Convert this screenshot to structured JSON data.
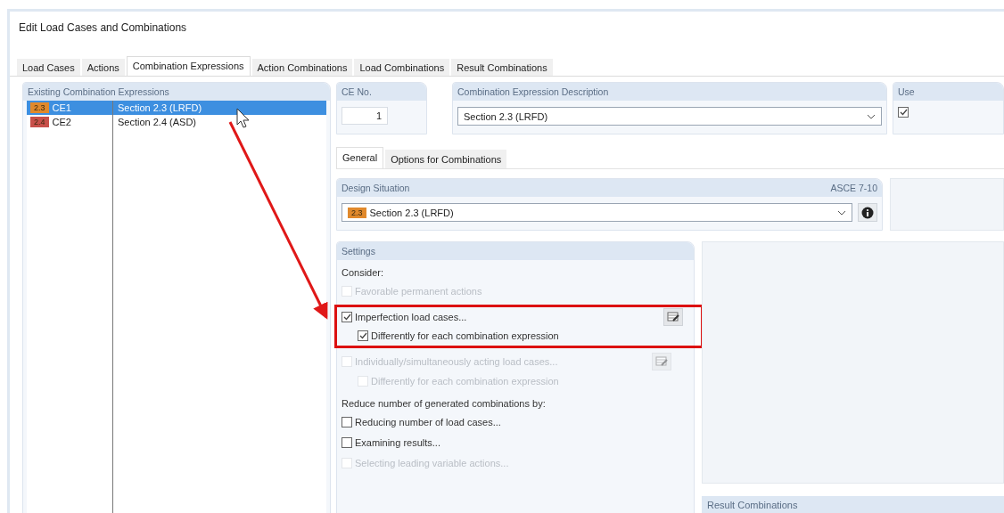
{
  "window": {
    "title": "Edit Load Cases and Combinations"
  },
  "tabs": [
    {
      "label": "Load Cases",
      "selected": false
    },
    {
      "label": "Actions",
      "selected": false
    },
    {
      "label": "Combination Expressions",
      "selected": true
    },
    {
      "label": "Action Combinations",
      "selected": false
    },
    {
      "label": "Load Combinations",
      "selected": false
    },
    {
      "label": "Result Combinations",
      "selected": false
    }
  ],
  "expressions": {
    "title": "Existing Combination Expressions",
    "rows": [
      {
        "badge": "2.3",
        "color": "#e0892c",
        "id": "CE1",
        "description": "Section 2.3 (LRFD)",
        "selected": true
      },
      {
        "badge": "2.4",
        "color": "#c8504a",
        "id": "CE2",
        "description": "Section 2.4 (ASD)",
        "selected": false
      }
    ]
  },
  "ce_no": {
    "label": "CE No.",
    "value": "1"
  },
  "description": {
    "label": "Combination Expression Description",
    "value": "Section 2.3 (LRFD)"
  },
  "use": {
    "label": "Use",
    "checked": true
  },
  "sub_tabs": [
    {
      "label": "General",
      "selected": true
    },
    {
      "label": "Options for Combinations",
      "selected": false
    }
  ],
  "design_situation": {
    "label": "Design Situation",
    "standard": "ASCE 7-10",
    "badge": "2.3",
    "color": "#e0892c",
    "value": "Section 2.3 (LRFD)"
  },
  "settings": {
    "title": "Settings",
    "consider_label": "Consider:",
    "consider": [
      {
        "label": "Favorable permanent actions",
        "checked": false,
        "disabled": true,
        "kind": "plain"
      },
      {
        "label": "Imperfection load cases...",
        "checked": true,
        "disabled": false,
        "highlighted": true,
        "kind": "with_button",
        "children": [
          {
            "label": "Differently for each combination expression",
            "checked": true,
            "disabled": false,
            "kind": "plain"
          }
        ]
      },
      {
        "label": "Individually/simultaneously acting load cases...",
        "checked": false,
        "disabled": true,
        "kind": "with_button",
        "children": [
          {
            "label": "Differently for each combination expression",
            "checked": false,
            "disabled": true,
            "kind": "plain"
          }
        ]
      }
    ],
    "reduce_label": "Reduce number of generated combinations by:",
    "reduce": [
      {
        "label": "Reducing number of load cases...",
        "checked": false,
        "disabled": false,
        "kind": "plain"
      },
      {
        "label": "Examining results...",
        "checked": false,
        "disabled": false,
        "kind": "plain"
      },
      {
        "label": "Selecting leading variable actions...",
        "checked": false,
        "disabled": true,
        "kind": "plain"
      }
    ]
  },
  "result_combinations": {
    "title": "Result Combinations"
  }
}
